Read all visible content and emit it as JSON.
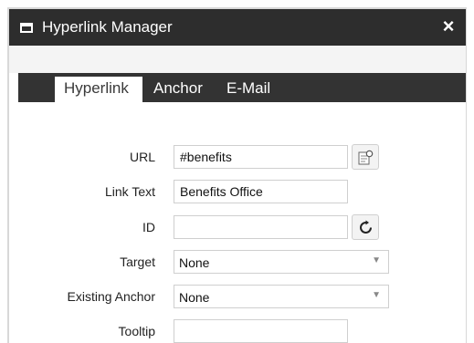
{
  "window": {
    "title": "Hyperlink Manager",
    "close_symbol": "×",
    "icon": "window-icon"
  },
  "tabs": [
    {
      "label": "Hyperlink",
      "active": true
    },
    {
      "label": "Anchor",
      "active": false
    },
    {
      "label": "E-Mail",
      "active": false
    }
  ],
  "form": {
    "url": {
      "label": "URL",
      "value": "#benefits",
      "button_icon": "document-browse-icon"
    },
    "link_text": {
      "label": "Link Text",
      "value": "Benefits Office"
    },
    "id": {
      "label": "ID",
      "value": "",
      "button_icon": "refresh-icon"
    },
    "target": {
      "label": "Target",
      "value": "None"
    },
    "existing_anchor": {
      "label": "Existing Anchor",
      "value": "None"
    },
    "tooltip": {
      "label": "Tooltip",
      "value": ""
    }
  },
  "colors": {
    "titlebar": "#2d2d2d",
    "tabstrip": "#333333",
    "active_tab": "#ffffff",
    "input_border": "#cfcfcf"
  }
}
